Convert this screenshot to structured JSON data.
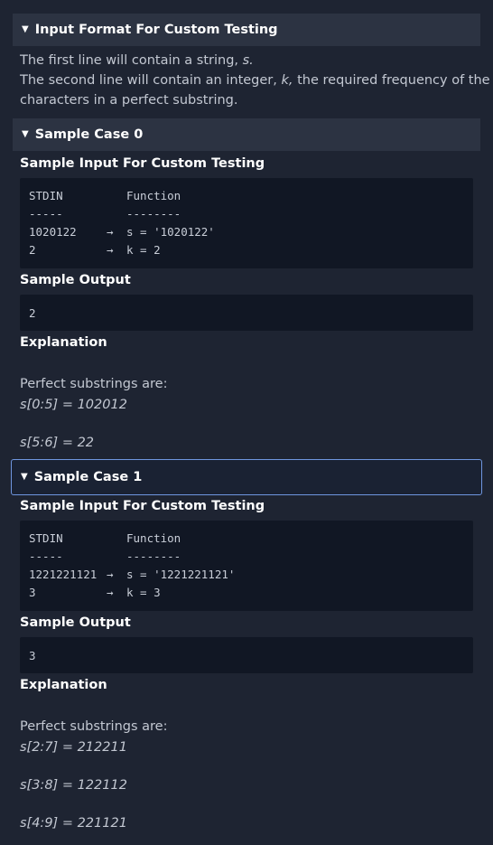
{
  "input_format": {
    "header": "Input Format For Custom Testing",
    "line1_prefix": "The first line will contain a string, ",
    "line1_var": "s.",
    "line2_prefix": "The second line will contain an integer, ",
    "line2_var": "k,",
    "line2_suffix": " the required frequency of the",
    "line3": "characters in a perfect substring."
  },
  "case0": {
    "header": "Sample Case 0",
    "input_title": "Sample Input For Custom Testing",
    "stdin_header": "STDIN",
    "function_header": "Function",
    "dash1": "-----",
    "dash2": "--------",
    "row1_left": "1020122",
    "row1_arrow": "→",
    "row1_right": "s = '1020122'",
    "row2_left": "2",
    "row2_arrow": "→",
    "row2_right": "k = 2",
    "output_title": "Sample Output",
    "output_value": "2",
    "explanation_title": "Explanation",
    "explanation_intro": "Perfect substrings are:",
    "substrings": [
      "s[0:5] = 102012",
      "s[5:6] = 22"
    ]
  },
  "case1": {
    "header": "Sample Case 1",
    "input_title": "Sample Input For Custom Testing",
    "stdin_header": "STDIN",
    "function_header": "Function",
    "dash1": "-----",
    "dash2": "--------",
    "row1_left": "1221221121",
    "row1_arrow": "→",
    "row1_right": "s = '1221221121'",
    "row2_left": "3",
    "row2_arrow": "→",
    "row2_right": "k = 3",
    "output_title": "Sample Output",
    "output_value": "3",
    "explanation_title": "Explanation",
    "explanation_intro": "Perfect substrings are:",
    "substrings": [
      "s[2:7] = 212211",
      "s[3:8] = 122112",
      "s[4:9] = 221121"
    ]
  },
  "icons": {
    "expanded": "triangle-down-icon"
  },
  "colors": {
    "background": "#1e2432",
    "header_bg": "#2c3342",
    "code_bg": "#111724",
    "active_border": "#6f96df"
  }
}
